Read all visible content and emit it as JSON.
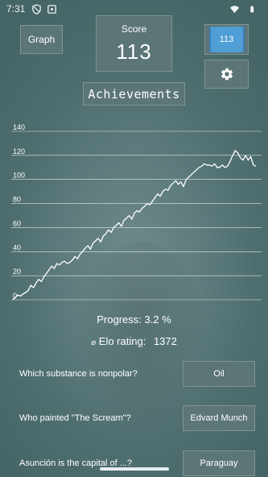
{
  "status_bar": {
    "time": "7:31",
    "left_icons": [
      "privacy-shield-icon",
      "notification-square-icon"
    ],
    "right_icons": [
      "wifi-icon",
      "battery-icon"
    ]
  },
  "header": {
    "graph_label": "Graph",
    "score_label": "Score",
    "score_value": "113",
    "counter_value": "113",
    "settings_icon": "gear-icon",
    "achievements_label": "Achievements"
  },
  "colors": {
    "accent": "#4f9fd6",
    "button_bg": "#5c7576",
    "background": "#5f7d7e"
  },
  "chart_data": {
    "type": "line",
    "title": "",
    "xlabel": "",
    "ylabel": "",
    "ylim": [
      0,
      140
    ],
    "yticks": [
      0,
      20,
      40,
      60,
      80,
      100,
      120,
      140
    ],
    "grid": true,
    "series": [
      {
        "values": [
          0,
          2,
          4,
          3,
          5,
          6,
          8,
          12,
          10,
          14,
          17,
          15,
          19,
          22,
          25,
          28,
          26,
          30,
          29,
          31,
          32,
          30,
          31,
          33,
          36,
          34,
          38,
          40,
          43,
          45,
          42,
          47,
          49,
          51,
          48,
          53,
          55,
          58,
          56,
          60,
          62,
          64,
          61,
          66,
          68,
          70,
          67,
          72,
          74,
          73,
          76,
          78,
          80,
          79,
          82,
          85,
          88,
          86,
          90,
          92,
          91,
          95,
          97,
          99,
          96,
          98,
          94,
          100,
          102,
          104,
          106,
          108,
          110,
          111,
          113,
          112,
          112,
          111,
          113,
          110,
          110,
          112,
          110,
          111,
          115,
          120,
          124,
          122,
          118,
          116,
          120,
          116,
          119,
          112,
          111
        ]
      }
    ]
  },
  "stats": {
    "progress_label": "Progress:",
    "progress_value": "3.2 %",
    "elo_symbol": "⌀",
    "elo_label": "Elo rating:",
    "elo_value": "1372"
  },
  "questions": [
    {
      "question": "Which substance is nonpolar?",
      "answer": "Oil"
    },
    {
      "question": "Who painted \"The Scream\"?",
      "answer": "Edvard Munch"
    },
    {
      "question": "Asunción is the capital of ...?",
      "answer": "Paraguay"
    }
  ]
}
